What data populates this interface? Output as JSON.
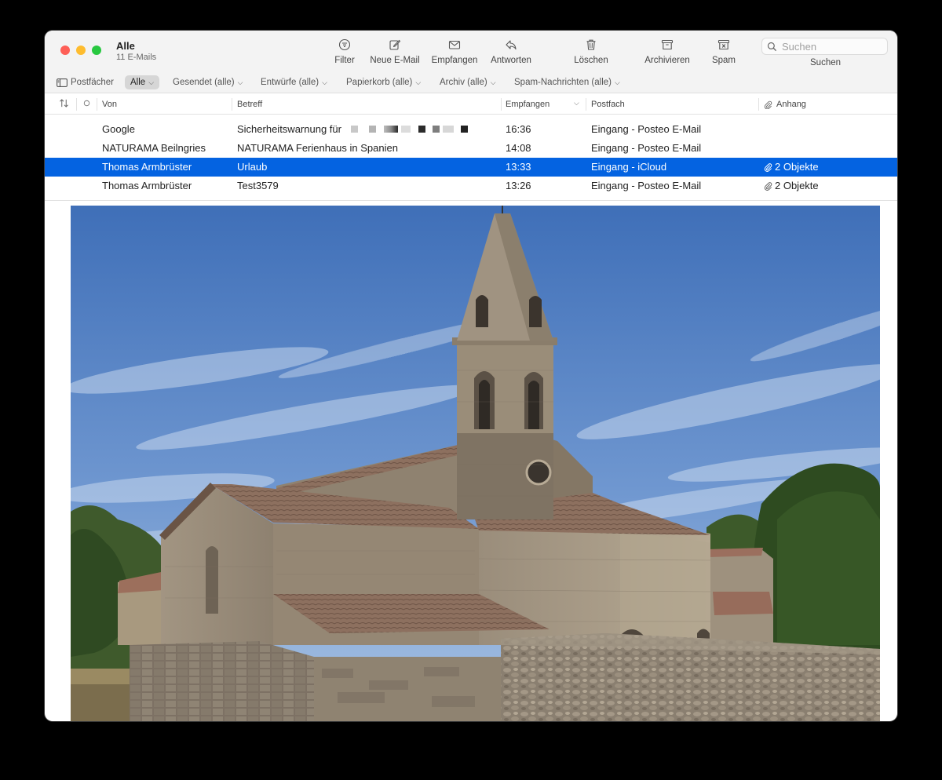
{
  "window": {
    "title": "Alle",
    "subtitle": "11 E-Mails"
  },
  "toolbar": {
    "filter": "Filter",
    "new_mail": "Neue E-Mail",
    "receive": "Empfangen",
    "reply": "Antworten",
    "delete": "Löschen",
    "archive": "Archivieren",
    "spam": "Spam",
    "search_label": "Suchen",
    "search_placeholder": "Suchen"
  },
  "favorites": {
    "mailboxes": "Postfächer",
    "all": "Alle",
    "sent": "Gesendet (alle)",
    "drafts": "Entwürfe (alle)",
    "trash": "Papierkorb (alle)",
    "archive": "Archiv (alle)",
    "spam": "Spam-Nachrichten (alle)"
  },
  "columns": {
    "from": "Von",
    "subject": "Betreff",
    "received": "Empfangen",
    "mailbox": "Postfach",
    "attachment": "Anhang"
  },
  "messages": [
    {
      "from": "Google",
      "subject": "Sicherheitswarnung für",
      "time": "16:36",
      "mailbox": "Eingang - Posteo E-Mail",
      "attachment": ""
    },
    {
      "from": "NATURAMA Beilngries",
      "subject": "NATURAMA Ferienhaus in Spanien",
      "time": "14:08",
      "mailbox": "Eingang - Posteo E-Mail",
      "attachment": ""
    },
    {
      "from": "Thomas Armbrüster",
      "subject": "Urlaub",
      "time": "13:33",
      "mailbox": "Eingang - iCloud",
      "attachment": "2 Objekte"
    },
    {
      "from": "Thomas Armbrüster",
      "subject": "Test3579",
      "time": "13:26",
      "mailbox": "Eingang - Posteo E-Mail",
      "attachment": "2 Objekte"
    }
  ],
  "colors": {
    "selection": "#0463e1",
    "toolbar_bg": "#f3f3f3"
  },
  "preview": {
    "image": "church-photo"
  }
}
